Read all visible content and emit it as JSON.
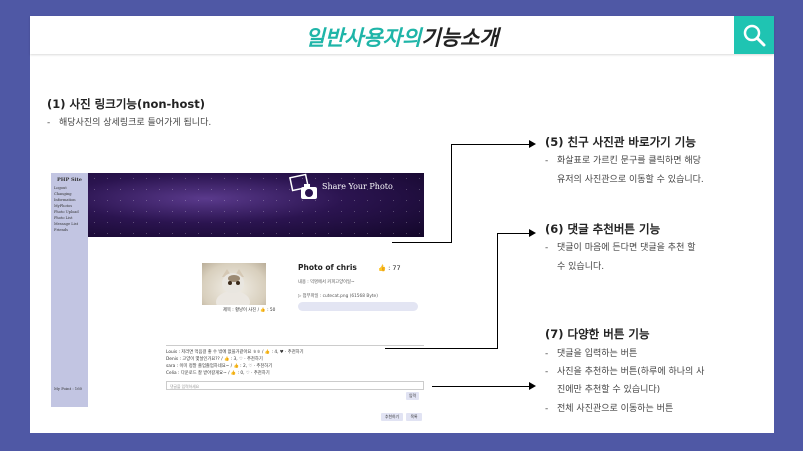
{
  "slide": {
    "title_accent": "일반사용자의",
    "title_rest": "기능소개"
  },
  "colors": {
    "frame": "#4f58a5",
    "accent": "#1fb5a8",
    "search_bg": "#1fc4b2"
  },
  "section1": {
    "heading": "(1) 사진 링크기능(non-host)",
    "bullets": [
      "해당사진의 상세링크로 들어가게 됩니다."
    ]
  },
  "section5": {
    "heading": "(5) 친구 사진관 바로가기 기능",
    "bullets": [
      "화살표로 가르킨 문구를 클릭하면 해당",
      "유저의 사진관으로 이동할 수 있습니다."
    ]
  },
  "section6": {
    "heading": "(6) 댓글 추천버튼 기능",
    "bullets": [
      "댓글이 마음에 든다면 댓글을 추천 할",
      "수 있습니다."
    ]
  },
  "section7": {
    "heading": "(7) 다양한 버튼 기능",
    "bullets": [
      "댓글을 입력하는 버튼",
      "사진을 추천하는 버튼(하루에 하나의 사",
      "진에만 추천할 수 있습니다)",
      "전체 사진관으로 이동하는 버튼"
    ]
  },
  "mock": {
    "site_name": "PHP Site",
    "nav": [
      "Logout",
      "Changing",
      "Information",
      "MyPhotos",
      "Photo Upload",
      "Photo List",
      "Message List",
      "Friends"
    ],
    "point": "My Point : 160",
    "banner_text": "Share Your Photo",
    "photo_title": "Photo of chris",
    "photo_likes": "👍 : 77",
    "photo_body": "내용 : 익명에서 커피고양이일~",
    "photo_attach": "▷ 첨부파일 : cutecat.png (61568 Byte)",
    "photo_caption": "제목 : 황냥이 사진 / 👍 : 50",
    "comments": [
      "Louis : 저러면 먹음걸 좋 수 밖에 없을거같아요 ㅎㅎ / 👍 : 4, ♥ · 추천하기",
      "Denis : 고양이 몇살인가요?? / 👍 : 3, ♡ · 추천하기",
      "sara : 이미 정말 졸업졸업하네요~ / 👍 : 2, ♡ · 추천하기",
      "Celia : 다운로드 잘 받아갈게요~ / 👍 : 0, ♡ · 추천하기"
    ],
    "comment_placeholder": "댓글을 입력하세요",
    "submit_label": "입력",
    "recommend_label": "추천하기",
    "list_label": "목록"
  }
}
